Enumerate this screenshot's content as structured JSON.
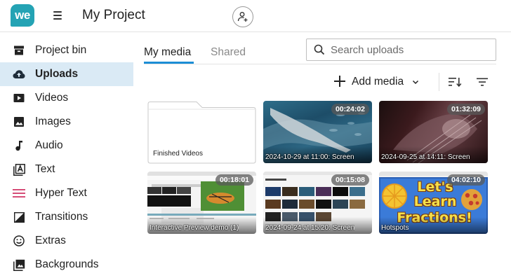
{
  "app": {
    "logo_text": "we",
    "project_title": "My Project"
  },
  "sidebar": {
    "items": [
      {
        "label": "Project bin",
        "icon": "archive-icon"
      },
      {
        "label": "Uploads",
        "icon": "cloud-upload-icon",
        "active": true
      },
      {
        "label": "Videos",
        "icon": "video-icon"
      },
      {
        "label": "Images",
        "icon": "image-icon"
      },
      {
        "label": "Audio",
        "icon": "music-note-icon"
      },
      {
        "label": "Text",
        "icon": "text-box-icon"
      },
      {
        "label": "Hyper Text",
        "icon": "hyper-text-icon"
      },
      {
        "label": "Transitions",
        "icon": "transition-icon"
      },
      {
        "label": "Extras",
        "icon": "smiley-icon"
      },
      {
        "label": "Backgrounds",
        "icon": "background-icon"
      }
    ]
  },
  "tabs": {
    "my_media": "My media",
    "shared": "Shared"
  },
  "search": {
    "placeholder": "Search uploads",
    "value": ""
  },
  "toolbar": {
    "add_media_label": "Add media"
  },
  "media": {
    "folder": {
      "name": "Finished Videos"
    },
    "items": [
      {
        "name": "2024-10-29 at 11:00: Screen",
        "duration": "00:24:02"
      },
      {
        "name": "2024-09-25 at 14:11: Screen",
        "duration": "01:32:09"
      },
      {
        "name": "Interactive Preview demo (1)",
        "duration": "00:18:01"
      },
      {
        "name": "2024-09-24 at 15:20: Screen",
        "duration": "00:15:08"
      },
      {
        "name": "Hotspots",
        "duration": "04:02:10"
      }
    ],
    "thumbnail_text": {
      "fractions_line1": "Let's",
      "fractions_line2": "Learn",
      "fractions_line3": "Fractions!"
    }
  },
  "colors": {
    "brand": "#24a3b4",
    "accent": "#1c8ed6",
    "active_bg": "#daeaf5",
    "hyper_text_icon": "#d23b6a"
  }
}
